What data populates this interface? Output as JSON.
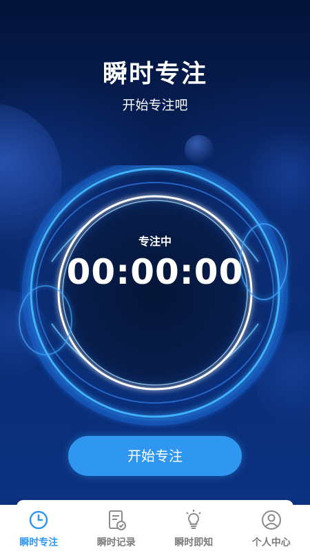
{
  "header": {
    "title": "瞬时专注",
    "subtitle": "开始专注吧"
  },
  "timer": {
    "status": "专注中",
    "time": "00:00:00"
  },
  "actions": {
    "start_label": "开始专注"
  },
  "tabbar": {
    "active_color": "#2f97f0",
    "inactive_color": "#7b7b7b",
    "items": [
      {
        "label": "瞬时专注",
        "icon": "clock-icon",
        "active": true
      },
      {
        "label": "瞬时记录",
        "icon": "record-document-icon",
        "active": false
      },
      {
        "label": "瞬时即知",
        "icon": "lightbulb-icon",
        "active": false
      },
      {
        "label": "个人中心",
        "icon": "user-profile-icon",
        "active": false
      }
    ]
  }
}
